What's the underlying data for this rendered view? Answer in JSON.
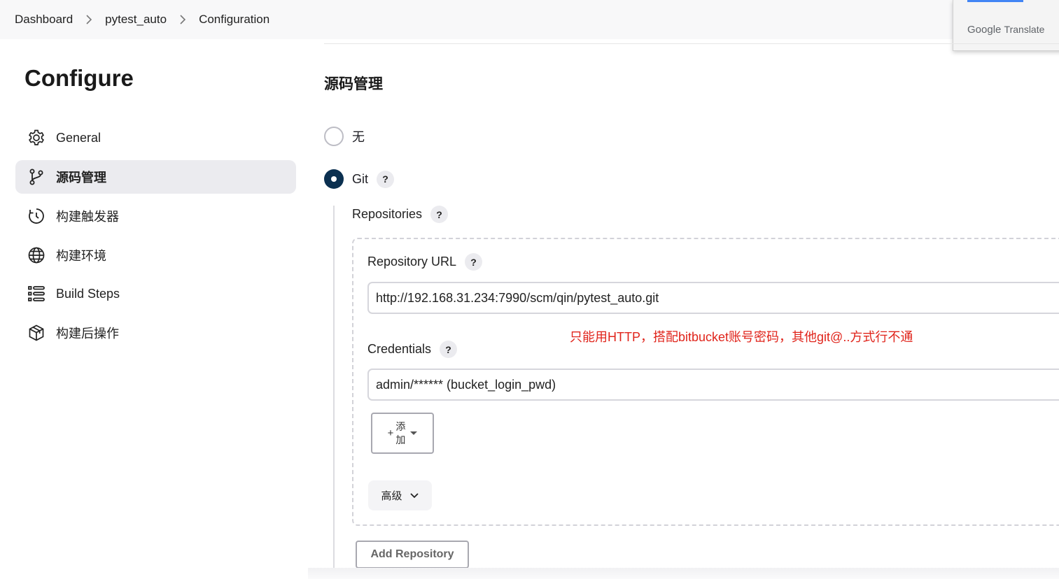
{
  "breadcrumb": {
    "items": [
      "Dashboard",
      "pytest_auto",
      "Configuration"
    ]
  },
  "google_translate": {
    "brand": "Google",
    "word": "Translate",
    "accent_color": "#4285f4"
  },
  "sidebar": {
    "title": "Configure",
    "items": [
      {
        "label": "General",
        "icon": "gear-icon",
        "active": false
      },
      {
        "label": "源码管理",
        "icon": "git-branch-icon",
        "active": true
      },
      {
        "label": "构建触发器",
        "icon": "clock-icon",
        "active": false
      },
      {
        "label": "构建环境",
        "icon": "globe-icon",
        "active": false
      },
      {
        "label": "Build Steps",
        "icon": "list-icon",
        "active": false
      },
      {
        "label": "构建后操作",
        "icon": "package-icon",
        "active": false
      }
    ]
  },
  "scm": {
    "title": "源码管理",
    "options": [
      {
        "label": "无",
        "selected": false
      },
      {
        "label": "Git",
        "selected": true
      }
    ],
    "help_symbol": "?",
    "repositories_label": "Repositories",
    "repository_url_label": "Repository URL",
    "repository_url_value": "http://192.168.31.234:7990/scm/qin/pytest_auto.git",
    "annotation": "只能用HTTP，搭配bitbucket账号密码，其他git@..方式行不通",
    "annotation_color": "#e0241b",
    "credentials_label": "Credentials",
    "credentials_value": "admin/****** (bucket_login_pwd)",
    "add_button": {
      "plus": "+",
      "label": "添加"
    },
    "advanced_label": "高级",
    "add_repository_label": "Add Repository"
  },
  "colors": {
    "radio_selected": "#0b3050",
    "active_sidebar_bg": "#ebebef"
  }
}
